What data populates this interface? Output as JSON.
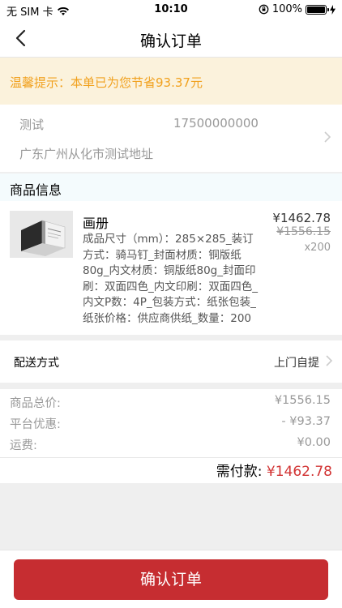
{
  "status_bar": {
    "carrier": "无 SIM 卡",
    "time": "10:10",
    "battery_percent": "100%",
    "battery_level": 1.0
  },
  "nav": {
    "title": "确认订单",
    "back_icon": "chevron-left-icon"
  },
  "tip": {
    "text": "温馨提示：本单已为您节省93.37元"
  },
  "address": {
    "name": "测试",
    "phone": "17500000000",
    "detail": "广东广州从化市测试地址"
  },
  "goods_section": {
    "title": "商品信息",
    "item": {
      "name": "画册",
      "desc": "成品尺寸（mm）：285×285_装订方式：骑马钉_封面材质：铜版纸80g_内文材质：铜版纸80g_封面印刷：双面四色_内文印刷：双面四色_内文P数：4P_包装方式：纸张包装_纸张价格：供应商供纸_数量：200",
      "price": "¥1462.78",
      "original_price": "¥1556.15",
      "quantity": "x200"
    }
  },
  "delivery": {
    "label": "配送方式",
    "value": "上门自提"
  },
  "summary": {
    "total_label": "商品总价:",
    "total_value": "¥1556.15",
    "discount_label": "平台优惠:",
    "discount_value": "- ¥93.37",
    "shipping_label": "运费:",
    "shipping_value": "¥0.00",
    "pay_label": "需付款:",
    "pay_value": "¥1462.78"
  },
  "bottom": {
    "confirm_label": "确认订单"
  },
  "colors": {
    "accent": "#c62d31",
    "tip_text": "#f1a11e",
    "tip_bg": "#fbf2dc"
  }
}
